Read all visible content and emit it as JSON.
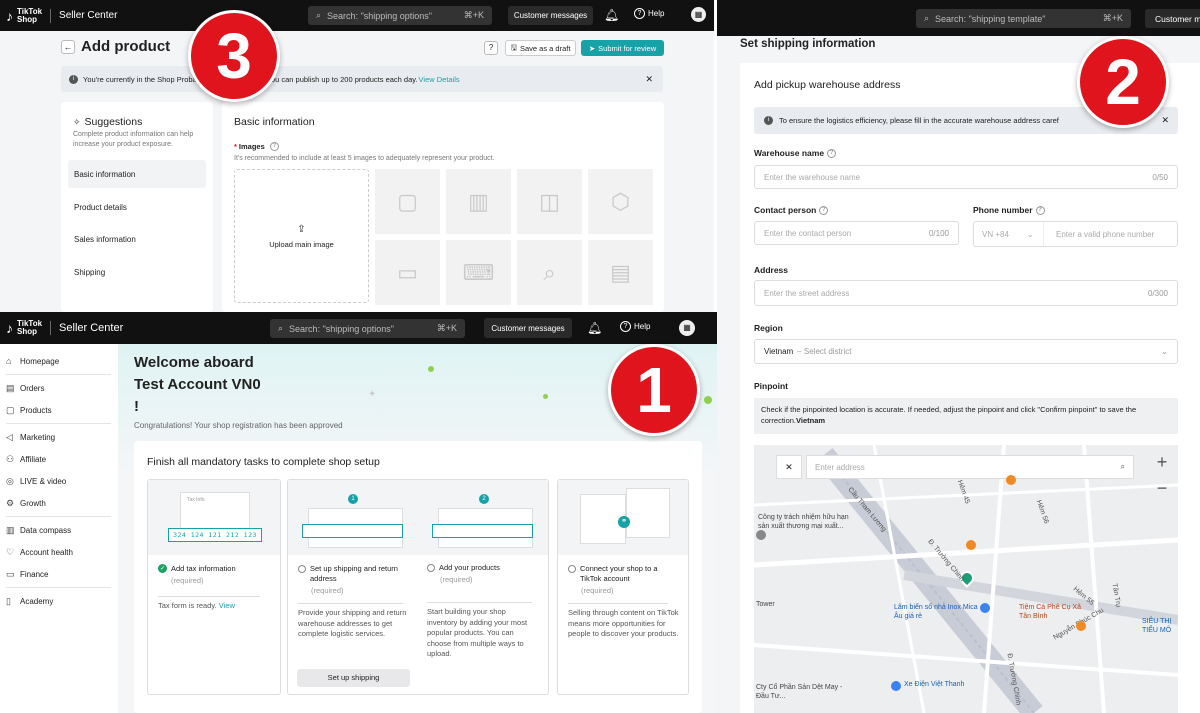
{
  "panel3": {
    "brand_top": "TikTok",
    "brand_bottom": "Shop",
    "app_name": "Seller Center",
    "search_placeholder": "Search: \"shipping options\"",
    "search_shortcut": "⌘+K",
    "customer_messages": "Customer messages",
    "help": "Help",
    "page_title": "Add product",
    "save_draft": "Save as a draft",
    "submit": "Submit for review",
    "banner_text_a": "You're currently in the Shop Probati",
    "banner_text_b": "age, you can publish up to 200 products each day.",
    "banner_link": "View Details",
    "suggestions_title": "Suggestions",
    "suggestions_desc": "Complete product information can help increase your product exposure.",
    "suggestion_items": [
      "Basic information",
      "Product details",
      "Sales information",
      "Shipping"
    ],
    "section_title": "Basic information",
    "images_label": "Images",
    "required_mark": "*",
    "images_hint": "It's recommended to include at least 5 images to adequately represent your product.",
    "upload_label": "Upload main image"
  },
  "panel2": {
    "search_placeholder": "Search: \"shipping template\"",
    "search_shortcut": "⌘+K",
    "customer_messages": "Customer m",
    "page_title": "Set shipping information",
    "card_title": "Add pickup warehouse address",
    "alert_text": "To ensure the logistics efficiency, please fill in the accurate warehouse address caref",
    "warehouse_name_label": "Warehouse name",
    "warehouse_name_placeholder": "Enter the warehouse name",
    "warehouse_name_count": "0/50",
    "contact_label": "Contact person",
    "contact_placeholder": "Enter the contact person",
    "contact_count": "0/100",
    "phone_label": "Phone number",
    "phone_code": "VN +84",
    "phone_placeholder": "Enter a valid phone number",
    "address_label": "Address",
    "address_placeholder": "Enter the street address",
    "address_count": "0/300",
    "region_label": "Region",
    "region_value": "Vietnam",
    "region_placeholder": "– Select district",
    "pinpoint_label": "Pinpoint",
    "pinpoint_text": "Check if the pinpointed location is accurate. If needed, adjust the pinpoint and click \"Confirm pinpoint\" to save the correction.",
    "pinpoint_bold": "Vietnam",
    "map_search_placeholder": "Enter address",
    "zoom_in": "+",
    "zoom_out": "−",
    "map_labels": [
      "Công ty trách nhiệm hữu hạn sản xuất thương mại xuất...",
      "Lâm biển số nhà Inox Mica - Âu giá rẻ",
      "Tiệm Cá Phê Cụ Xã Tân Bình",
      "Xe Điện Việt Thanh",
      "Cty Cổ Phần Sản Dệt May - Đầu Tư...",
      "Cầu Tham Lương",
      "Đ. Trường Chinh",
      "Nguyễn Phúc Chu",
      "Hẻm 55",
      "Tân Trụ",
      "SIÊU THỊ TIỂU MÔ",
      "Hẻm 56",
      "Hẻm 45",
      "Tower",
      "Đ. Trường Chinh"
    ]
  },
  "panel1": {
    "brand_top": "TikTok",
    "brand_bottom": "Shop",
    "app_name": "Seller Center",
    "search_placeholder": "Search: \"shipping options\"",
    "search_shortcut": "⌘+K",
    "customer_messages": "Customer messages",
    "help": "Help",
    "nav": [
      "Homepage",
      "Orders",
      "Products",
      "Marketing",
      "Affiliate",
      "LIVE & video",
      "Growth",
      "Data compass",
      "Account health",
      "Finance",
      "Academy"
    ],
    "welcome_line1": "Welcome aboard",
    "welcome_line2": "Test Account VN0",
    "welcome_line3": "!",
    "congrats": "Congratulations! Your shop registration has been approved",
    "tasks_title": "Finish all mandatory tasks to complete shop setup",
    "tax_digits": "324 124 121 212 123",
    "tax_info_small": "Tax Info",
    "step1": "1",
    "step2": "2",
    "tasks": [
      {
        "title": "Add tax information",
        "required": "(required)",
        "desc": "Tax form is ready.",
        "link": "View"
      },
      {
        "title": "Set up shipping and return address",
        "required": "(required)",
        "desc": "Provide your shipping and return warehouse addresses to get complete logistic services.",
        "button": "Set up shipping"
      },
      {
        "title": "Add your products",
        "required": "(required)",
        "desc": "Start building your shop inventory by adding your most popular products. You can choose from multiple ways to upload."
      },
      {
        "title": "Connect your shop to a TikTok account",
        "required": "(required)",
        "desc": "Selling through content on TikTok means more opportunities for people to discover your products."
      }
    ]
  },
  "badges": {
    "one": "1",
    "two": "2",
    "three": "3"
  },
  "colors": {
    "accent": "#16a2a6",
    "badge": "#e0141c",
    "topbar": "#111111"
  }
}
